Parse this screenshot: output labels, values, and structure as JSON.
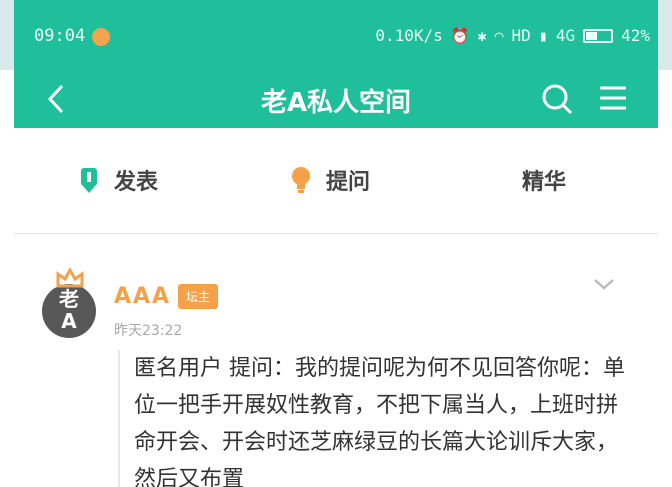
{
  "status_bar": {
    "time": "09:04",
    "net_speed": "0.10K/s",
    "hd": "HD",
    "signal": "4G",
    "battery": "42%",
    "icons": [
      "alarm-icon",
      "bluetooth-icon",
      "wifi-icon",
      "signal-icon",
      "battery-icon"
    ]
  },
  "toolbar": {
    "title": "老A私人空间",
    "icons": [
      "back-icon",
      "search-icon",
      "menu-icon"
    ]
  },
  "tabs": [
    {
      "label": "发表",
      "icon": "pen-icon",
      "color": "#1ebf9a"
    },
    {
      "label": "提问",
      "icon": "lightbulb-icon",
      "color": "#f4a14a"
    },
    {
      "label": "精华"
    }
  ],
  "post": {
    "avatar_text_top": "老",
    "avatar_text_bottom": "A",
    "author": "AAA",
    "badge": "坛主",
    "time": "昨天23:22",
    "content": "匿名用户 提问：我的提问呢为何不见回答你呢：单位一把手开展奴性教育，不把下属当人，上班时拼命开会、开会时还芝麻绿豆的长篇大论训斥大家，然后又布置"
  },
  "colors": {
    "accent": "#1ebf9a",
    "orange": "#f4a14a"
  }
}
